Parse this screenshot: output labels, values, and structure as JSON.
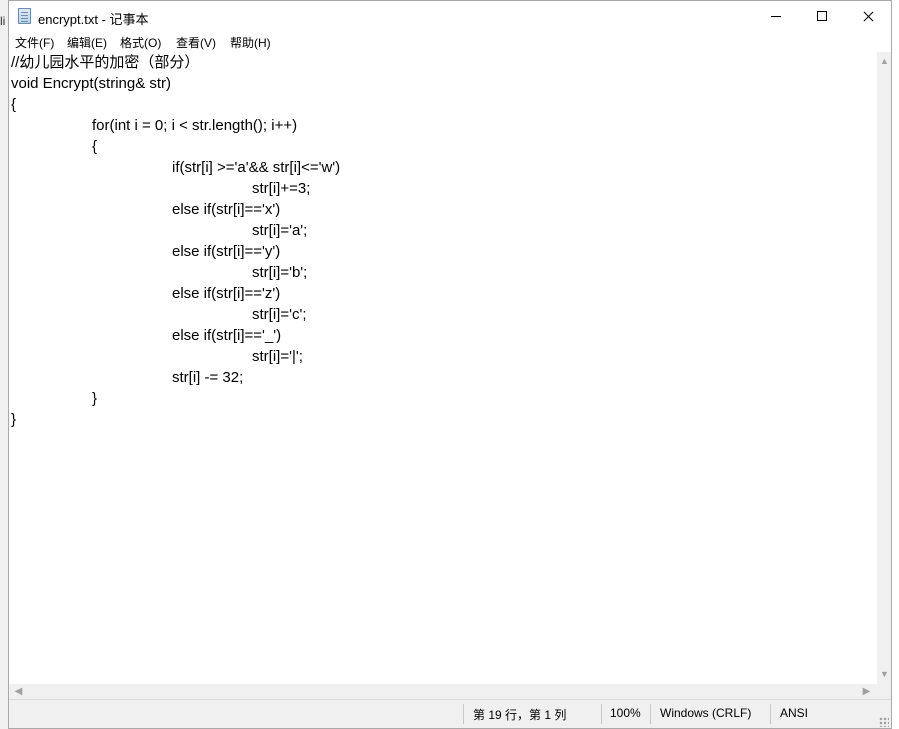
{
  "background": {
    "fragment": "li"
  },
  "window": {
    "title": "encrypt.txt - 记事本"
  },
  "menu": {
    "items": [
      {
        "label": "文件(F)"
      },
      {
        "label": "编辑(E)"
      },
      {
        "label": "格式(O)"
      },
      {
        "label": "查看(V)"
      },
      {
        "label": "帮助(H)"
      }
    ]
  },
  "editor": {
    "lines": [
      "//幼儿园水平的加密（部分）",
      "void Encrypt(string& str)",
      "{",
      "for(int i = 0; i < str.length(); i++)",
      "{",
      "if(str[i] >='a'&& str[i]<='w')",
      "str[i]+=3;",
      "else if(str[i]=='x')",
      "str[i]='a';",
      "else if(str[i]=='y')",
      "str[i]='b';",
      "else if(str[i]=='z')",
      "str[i]='c';",
      "else if(str[i]=='_')",
      "str[i]='|';",
      "str[i] -= 32;",
      "}",
      "}"
    ]
  },
  "status": {
    "position": "第 19 行，第 1 列",
    "zoom": "100%",
    "line_ending": "Windows (CRLF)",
    "encoding": "ANSI"
  },
  "colors": {
    "titlebar": "#ffffff",
    "statusbar": "#f0f0f0",
    "text": "#000000"
  }
}
